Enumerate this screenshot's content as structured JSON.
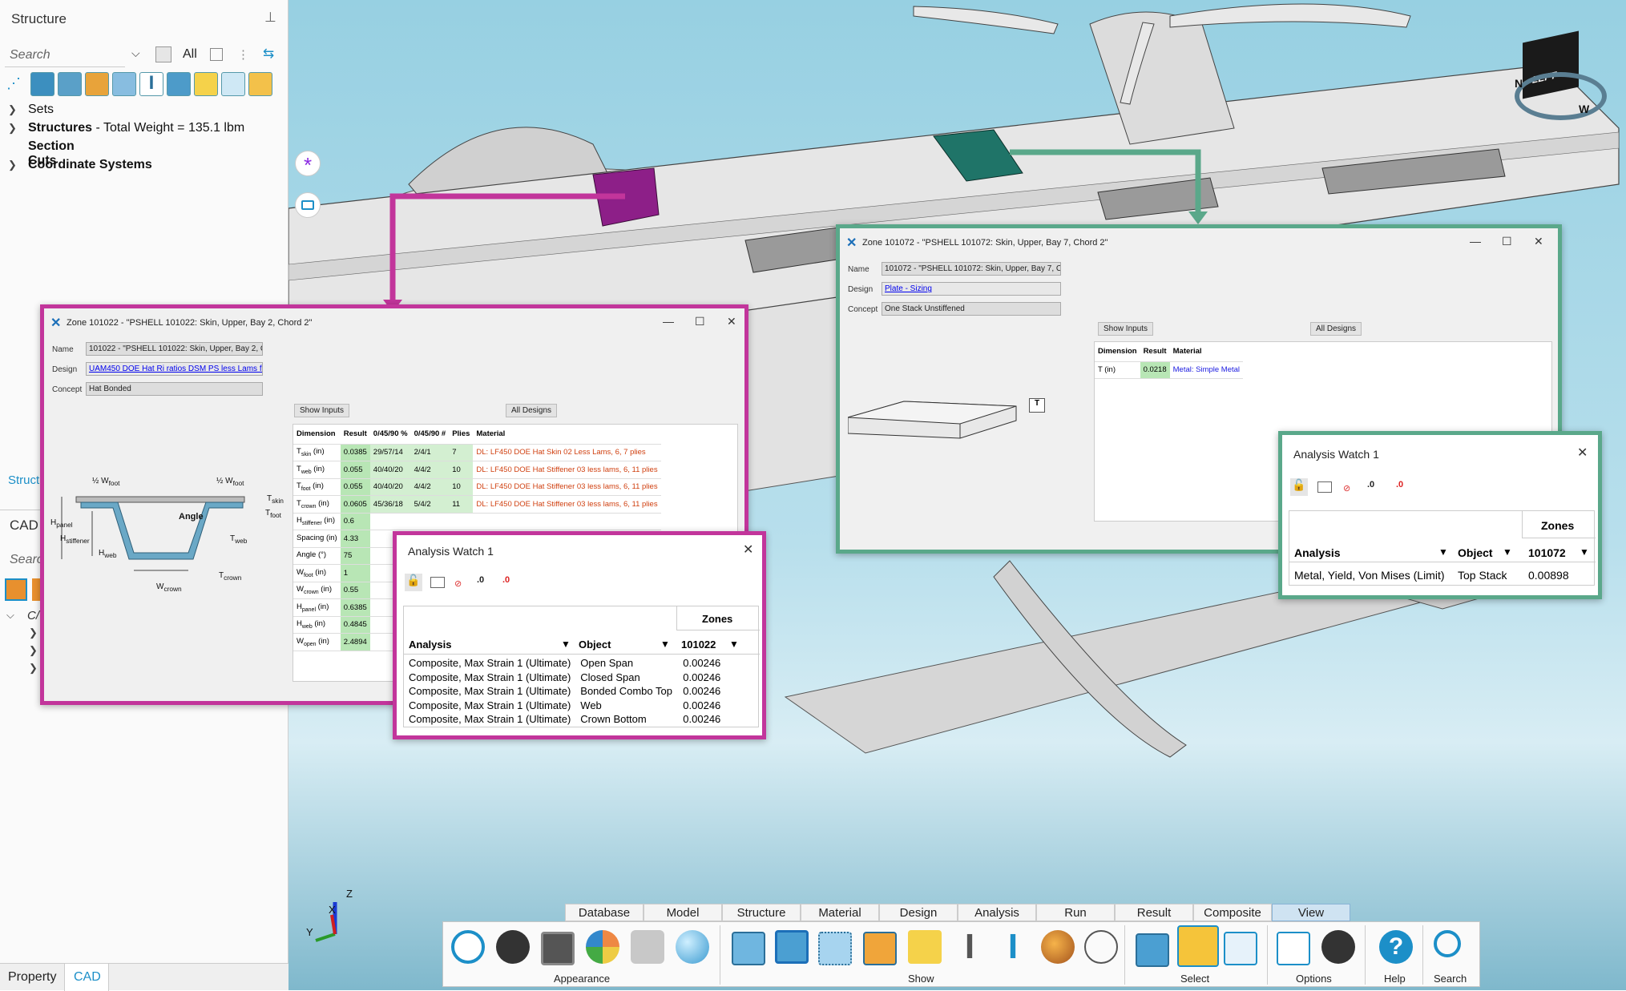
{
  "left_panel": {
    "title": "Structure",
    "search_placeholder": "Search",
    "filter_label": "All",
    "tree": [
      {
        "label": "Sets",
        "suffix": ""
      },
      {
        "label": "Structures",
        "suffix": " - Total Weight = 135.1 lbm"
      },
      {
        "label": "Section Cuts",
        "suffix": ""
      },
      {
        "label": "Coordinate Systems",
        "suffix": ""
      }
    ],
    "struct_partial": "Struct",
    "cad_header": "CAD",
    "cad_search": "Searc",
    "cad_tree_first": "C/",
    "bottom_tabs": [
      "Property",
      "CAD"
    ]
  },
  "zone1": {
    "title": "Zone 101022 - \"PSHELL 101022: Skin, Upper, Bay 2, Chord 2\"",
    "name_label": "Name",
    "name_value": "101022 - \"PSHELL 101022: Skin, Upper, Bay 2, Cho",
    "design_label": "Design",
    "design_value": "UAM450 DOE Hat Ri ratios DSM PS less Lams for h",
    "concept_label": "Concept",
    "concept_value": "Hat Bonded",
    "show_inputs": "Show Inputs",
    "all_designs": "All Designs",
    "headers": [
      "Dimension",
      "Result",
      "0/45/90 %",
      "0/45/90 #",
      "Plies",
      "Material"
    ],
    "rows": [
      {
        "dim": "T",
        "sub": "skin",
        "unit": " (in)",
        "result": "0.0385",
        "pct": "29/57/14",
        "num": "2/4/1",
        "plies": "7",
        "mat": "DL: LF450 DOE Hat Skin 02 Less Lams, 6, 7 plies"
      },
      {
        "dim": "T",
        "sub": "web",
        "unit": " (in)",
        "result": "0.055",
        "pct": "40/40/20",
        "num": "4/4/2",
        "plies": "10",
        "mat": "DL: LF450 DOE Hat Stiffener 03 less lams, 6, 11 plies"
      },
      {
        "dim": "T",
        "sub": "foot",
        "unit": " (in)",
        "result": "0.055",
        "pct": "40/40/20",
        "num": "4/4/2",
        "plies": "10",
        "mat": "DL: LF450 DOE Hat Stiffener 03 less lams, 6, 11 plies"
      },
      {
        "dim": "T",
        "sub": "crown",
        "unit": " (in)",
        "result": "0.0605",
        "pct": "45/36/18",
        "num": "5/4/2",
        "plies": "11",
        "mat": "DL: LF450 DOE Hat Stiffener 03 less lams, 6, 11 plies"
      },
      {
        "dim": "H",
        "sub": "stiffener",
        "unit": " (in)",
        "result": "0.6",
        "pct": "",
        "num": "",
        "plies": "",
        "mat": ""
      },
      {
        "dim": "Spacing",
        "sub": "",
        "unit": " (in)",
        "result": "4.33",
        "pct": "",
        "num": "",
        "plies": "",
        "mat": ""
      },
      {
        "dim": "Angle",
        "sub": "",
        "unit": " (°)",
        "result": "75",
        "pct": "",
        "num": "",
        "plies": "",
        "mat": ""
      },
      {
        "dim": "W",
        "sub": "foot",
        "unit": " (in)",
        "result": "1",
        "pct": "",
        "num": "",
        "plies": "",
        "mat": ""
      },
      {
        "dim": "W",
        "sub": "crown",
        "unit": " (in)",
        "result": "0.55",
        "pct": "",
        "num": "",
        "plies": "",
        "mat": ""
      },
      {
        "dim": "H",
        "sub": "panel",
        "unit": " (in)",
        "result": "0.6385",
        "pct": "",
        "num": "",
        "plies": "",
        "mat": ""
      },
      {
        "dim": "H",
        "sub": "web",
        "unit": " (in)",
        "result": "0.4845",
        "pct": "",
        "num": "",
        "plies": "",
        "mat": ""
      },
      {
        "dim": "W",
        "sub": "open",
        "unit": " (in)",
        "result": "2.4894",
        "pct": "",
        "num": "",
        "plies": "",
        "mat": ""
      }
    ],
    "diagram_labels": {
      "half_wfoot_l": "½ W",
      "half_wfoot_r": "½ W",
      "foot": "foot",
      "tskin": "T",
      "skin": "skin",
      "tfoot": "T",
      "foot2": "foot",
      "hpanel": "H",
      "panel": "panel",
      "angle": "Angle",
      "hstiff": "H",
      "stiffener": "stiffener",
      "tweb": "T",
      "web": "web",
      "hweb": "H",
      "web2": "web",
      "tcrown": "T",
      "crown": "crown",
      "wcrown": "W",
      "crown2": "crown"
    }
  },
  "aw1": {
    "title": "Analysis Watch 1",
    "zones_label": "Zones",
    "col_analysis": "Analysis",
    "col_object": "Object",
    "col_zone": "101022",
    "rows": [
      {
        "analysis": "Composite, Max Strain 1 (Ultimate)",
        "object": "Open Span",
        "value": "0.00246"
      },
      {
        "analysis": "Composite, Max Strain 1 (Ultimate)",
        "object": "Closed Span",
        "value": "0.00246"
      },
      {
        "analysis": "Composite, Max Strain 1 (Ultimate)",
        "object": "Bonded Combo Top",
        "value": "0.00246"
      },
      {
        "analysis": "Composite, Max Strain 1 (Ultimate)",
        "object": "Web",
        "value": "0.00246"
      },
      {
        "analysis": "Composite, Max Strain 1 (Ultimate)",
        "object": "Crown Bottom",
        "value": "0.00246"
      }
    ]
  },
  "zone2": {
    "title": "Zone 101072 - \"PSHELL 101072: Skin, Upper, Bay 7, Chord 2\"",
    "name_label": "Name",
    "name_value": "101072 - \"PSHELL 101072: Skin, Upper, Bay 7, Cho",
    "design_label": "Design",
    "design_value": "Plate - Sizing",
    "concept_label": "Concept",
    "concept_value": "One Stack Unstiffened",
    "show_inputs": "Show Inputs",
    "all_designs": "All Designs",
    "headers": [
      "Dimension",
      "Result",
      "Material"
    ],
    "row": {
      "dim": "T (in)",
      "result": "0.0218",
      "mat": "Metal: Simple Metal"
    },
    "plate_label": "T"
  },
  "aw2": {
    "title": "Analysis Watch 1",
    "zones_label": "Zones",
    "col_analysis": "Analysis",
    "col_object": "Object",
    "col_zone": "101072",
    "row": {
      "analysis": "Metal, Yield, Von Mises (Limit)",
      "object": "Top Stack",
      "value": "0.00898"
    }
  },
  "viewcube": {
    "face": "LEFT",
    "n": "N",
    "w": "W"
  },
  "triad": {
    "x": "X",
    "y": "Y",
    "z": "Z"
  },
  "ribbon": {
    "tabs": [
      "Database",
      "Model",
      "Structure",
      "Material",
      "Design",
      "Analysis",
      "Run",
      "Result",
      "Composite",
      "View"
    ],
    "active": "View",
    "groups": [
      "Appearance",
      "Show",
      "Select",
      "Options",
      "Help",
      "Search"
    ]
  },
  "colors": {
    "magenta": "#c2359b",
    "teal": "#5aa88a",
    "accent": "#1c8fc8"
  }
}
